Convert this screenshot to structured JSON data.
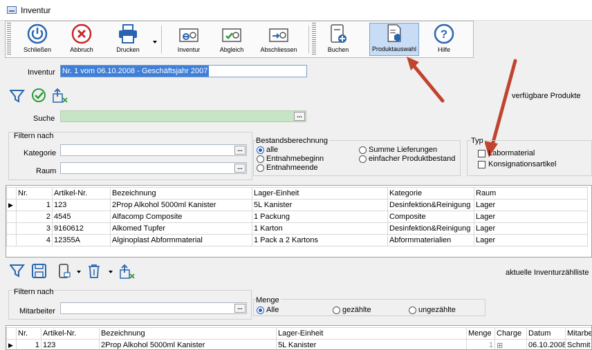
{
  "window": {
    "title": "Inventur"
  },
  "toolbar": {
    "buttons": [
      {
        "label": "Schließen",
        "icon": "power-icon"
      },
      {
        "label": "Abbruch",
        "icon": "cancel-icon"
      },
      {
        "label": "Drucken",
        "icon": "printer-icon"
      },
      {
        "label": "Inventur",
        "icon": "inventory-icon"
      },
      {
        "label": "Abgleich",
        "icon": "reconcile-icon"
      },
      {
        "label": "Abschliessen",
        "icon": "finish-icon"
      },
      {
        "label": "Buchen",
        "icon": "book-icon"
      },
      {
        "label": "Produktauswahl",
        "icon": "product-select-icon"
      },
      {
        "label": "Hilfe",
        "icon": "help-icon"
      }
    ]
  },
  "header": {
    "inventur_label": "Inventur",
    "inventur_value": "Nr. 1 vom 06.10.2008 - Geschäftsjahr 2007"
  },
  "products_section": {
    "title": "verfügbare Produkte",
    "search_label": "Suche",
    "filter_title": "Filtern nach",
    "kategorie_label": "Kategorie",
    "raum_label": "Raum",
    "bestand_title": "Bestandsberechnung",
    "bestand_options": [
      "alle",
      "Entnahmebeginn",
      "Entnahmeende",
      "Summe Lieferungen",
      "einfacher Produktbestand"
    ],
    "typ_title": "Typ",
    "typ_options": [
      "Labormaterial",
      "Konsignationsartikel"
    ]
  },
  "products_table": {
    "columns": [
      "Nr.",
      "Artikel-Nr.",
      "Bezeichnung",
      "Lager-Einheit",
      "Kategorie",
      "Raum"
    ],
    "rows": [
      [
        "1",
        "123",
        "2Prop Alkohol 5000ml Kanister",
        "5L Kanister",
        "Desinfektion&Reinigung",
        "Lager"
      ],
      [
        "2",
        "4545",
        "Alfacomp Composite",
        "1 Packung",
        "Composite",
        "Lager"
      ],
      [
        "3",
        "9160612",
        "Alkomed Tupfer",
        "1 Karton",
        "Desinfektion&Reinigung",
        "Lager"
      ],
      [
        "4",
        "12355A",
        "Alginoplast Abformmaterial",
        "1 Pack a 2 Kartons",
        "Abformmaterialien",
        "Lager"
      ]
    ]
  },
  "count_section": {
    "title": "aktuelle Inventurzählliste",
    "filter_title": "Filtern nach",
    "mitarbeiter_label": "Mitarbeiter",
    "menge_title": "Menge",
    "menge_options": [
      "Alle",
      "gezählte",
      "ungezählte"
    ]
  },
  "count_table": {
    "columns": [
      "Nr.",
      "Artikel-Nr.",
      "Bezeichnung",
      "Lager-Einheit",
      "Menge",
      "Charge",
      "Datum",
      "Mitarbe"
    ],
    "rows": [
      [
        "1",
        "123",
        "2Prop Alkohol 5000ml Kanister",
        "5L Kanister",
        "1",
        "⊞",
        "06.10.2008",
        "Schmit"
      ]
    ]
  },
  "colors": {
    "selection": "#3f7fd8",
    "search_bg": "#c8e4c6",
    "arrow": "#c0442f",
    "icon_blue": "#2a66b0"
  }
}
